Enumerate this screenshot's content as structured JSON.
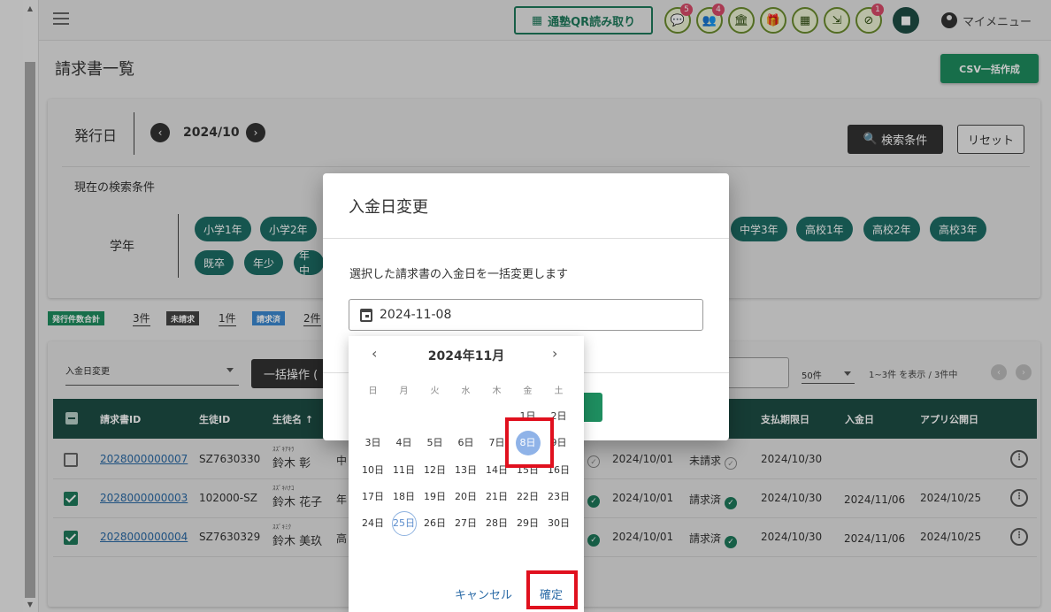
{
  "header": {
    "qr_button": "通塾QR読み取り",
    "my_menu": "マイメニュー",
    "icons": [
      {
        "name": "chat-icon",
        "glyph": "💬",
        "badge": "5"
      },
      {
        "name": "group-icon",
        "glyph": "👥",
        "badge": "4"
      },
      {
        "name": "school-icon",
        "glyph": "🏛",
        "badge": ""
      },
      {
        "name": "gift-icon",
        "glyph": "🎁",
        "badge": ""
      },
      {
        "name": "report-icon",
        "glyph": "▦",
        "badge": ""
      },
      {
        "name": "collapse-icon",
        "glyph": "⇲",
        "badge": ""
      },
      {
        "name": "blocked-icon",
        "glyph": "⊘",
        "badge": "1"
      }
    ]
  },
  "page": {
    "title": "請求書一覧",
    "csv_button": "CSV一括作成"
  },
  "search": {
    "issue_label": "発行日",
    "issue_month": "2024/10",
    "search_button": "検索条件",
    "reset_button": "リセット",
    "current_conditions": "現在の検索条件",
    "grade_label": "学年",
    "chips": [
      "小学1年",
      "小学2年",
      "中学3年",
      "高校1年",
      "高校2年",
      "高校3年",
      "既卒",
      "年少",
      "年中"
    ]
  },
  "stats": {
    "issued_label": "発行件数合計",
    "issued_count": "3件",
    "unbilled_label": "未請求",
    "unbilled_count": "1件",
    "billed_label": "請求済",
    "billed_count": "2件"
  },
  "table": {
    "action_select": "入金日変更",
    "bulk_button": "一括操作 (",
    "per_page": "50件",
    "range_text": "1~3件 を表示 / 3件中",
    "headers": {
      "invoice_id": "請求書ID",
      "student_id": "生徒ID",
      "student_name": "生徒名 ↑",
      "due": "支払期限日",
      "paid": "入金日",
      "app": "アプリ公開日"
    },
    "rows": [
      {
        "checked": false,
        "invoice_id": "2028000000007",
        "student_id": "SZ7630330",
        "ruby": "ｽｽﾞｷｱｷﾗ",
        "name": "鈴木 彰",
        "grade": "中",
        "issue_date": "2024/10/01",
        "status": "未請求",
        "due": "2024/10/30",
        "paid": "",
        "app": ""
      },
      {
        "checked": true,
        "invoice_id": "2028000000003",
        "student_id": "102000-SZ",
        "ruby": "ｽｽﾞｷﾊﾅｺ",
        "name": "鈴木 花子",
        "grade": "年",
        "issue_date": "2024/10/01",
        "status": "請求済",
        "due": "2024/10/30",
        "paid": "2024/11/06",
        "app": "2024/10/25"
      },
      {
        "checked": true,
        "invoice_id": "2028000000004",
        "student_id": "SZ7630329",
        "ruby": "ｽｽﾞｷﾐｸ",
        "name": "鈴木 美玖",
        "grade": "高",
        "issue_date": "2024/10/01",
        "status": "請求済",
        "due": "2024/10/30",
        "paid": "2024/11/06",
        "app": "2024/10/25"
      }
    ]
  },
  "dialog": {
    "title": "入金日変更",
    "description": "選択した請求書の入金日を一括変更します",
    "date_value": "2024-11-08"
  },
  "picker": {
    "month_label": "2024年11月",
    "weekdays": [
      "日",
      "月",
      "火",
      "水",
      "木",
      "金",
      "土"
    ],
    "first_weekday": 5,
    "days_in_month": 30,
    "today": 25,
    "selected": 8,
    "day_suffix": "日",
    "cancel": "キャンセル",
    "confirm": "確定"
  }
}
